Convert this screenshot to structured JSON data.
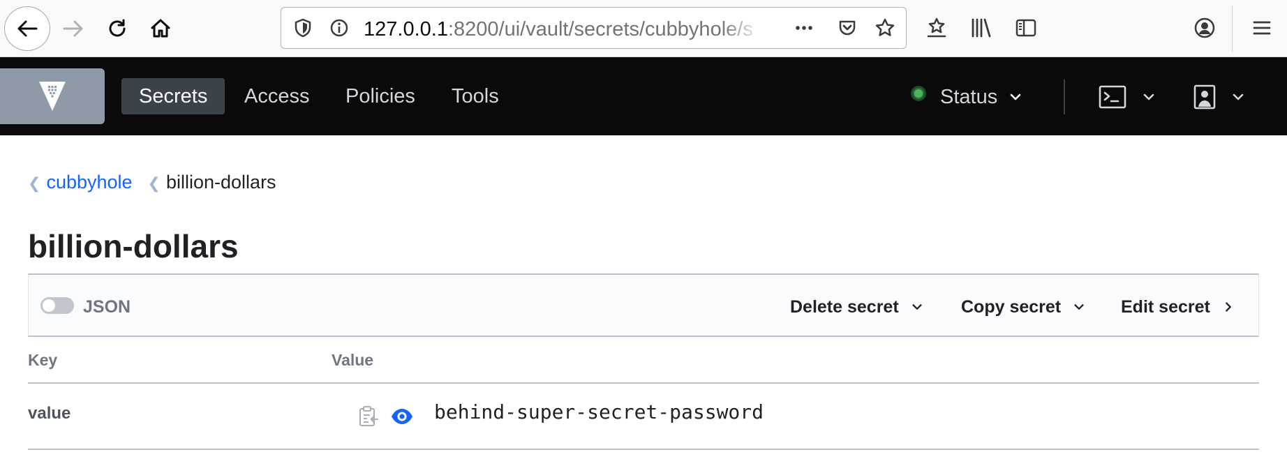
{
  "browser": {
    "url_host": "127.0.0.1",
    "url_path": ":8200/ui/vault/secrets/cubbyhole/s",
    "icons": {
      "back": "back-arrow-icon",
      "forward": "forward-arrow-icon",
      "reload": "reload-icon",
      "home": "home-icon",
      "tracking": "shield-icon",
      "info": "info-icon",
      "page_actions": "ellipsis-icon",
      "pocket": "pocket-icon",
      "bookmark": "star-icon",
      "bookmarks_menu": "star-list-icon",
      "library": "library-icon",
      "sidebar": "sidebar-icon",
      "account": "account-icon",
      "menu": "hamburger-icon"
    }
  },
  "vault_nav": {
    "items": [
      {
        "label": "Secrets",
        "active": true
      },
      {
        "label": "Access",
        "active": false
      },
      {
        "label": "Policies",
        "active": false
      },
      {
        "label": "Tools",
        "active": false
      }
    ],
    "status_label": "Status",
    "status_color": "#4fb35f",
    "icons": {
      "logo": "vault-logo-icon",
      "console": "terminal-icon",
      "user": "user-icon",
      "chevron": "chevron-down-icon"
    }
  },
  "breadcrumb": {
    "parent": "cubbyhole",
    "current": "billion-dollars"
  },
  "page_title": "billion-dollars",
  "toolbar": {
    "json_label": "JSON",
    "json_enabled": false,
    "delete_label": "Delete secret",
    "copy_label": "Copy secret",
    "edit_label": "Edit secret"
  },
  "table": {
    "columns": [
      "Key",
      "Value"
    ],
    "rows": [
      {
        "key": "value",
        "value": "behind-super-secret-password"
      }
    ]
  },
  "colors": {
    "link": "#1563ff",
    "nav_bg": "#0a0a0a",
    "nav_active_bg": "#3b4249",
    "logo_bg": "#8f9aa8",
    "reveal_icon": "#1563ff"
  }
}
